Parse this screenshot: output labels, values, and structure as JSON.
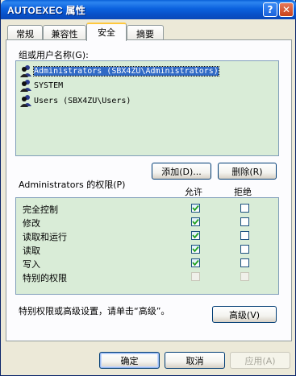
{
  "window": {
    "title": "AUTOEXEC 属性"
  },
  "titlebar": {
    "help_label": "?",
    "close_label": "✕"
  },
  "tabs": [
    {
      "label": "常规",
      "active": false
    },
    {
      "label": "兼容性",
      "active": false
    },
    {
      "label": "安全",
      "active": true
    },
    {
      "label": "摘要",
      "active": false
    }
  ],
  "security": {
    "group_label": "组或用户名称(G):",
    "users": [
      {
        "name": "Administrators (SBX4ZU\\Administrators)",
        "selected": true,
        "icon": "users-icon"
      },
      {
        "name": "SYSTEM",
        "selected": false,
        "icon": "users-icon"
      },
      {
        "name": "Users (SBX4ZU\\Users)",
        "selected": false,
        "icon": "users-icon"
      }
    ],
    "add_label": "添加(D)...",
    "remove_label": "删除(R)",
    "perm_title": "Administrators 的权限(P)",
    "allow_header": "允许",
    "deny_header": "拒绝",
    "permissions": [
      {
        "name": "完全控制",
        "allow": true,
        "deny": false,
        "enabled": true
      },
      {
        "name": "修改",
        "allow": true,
        "deny": false,
        "enabled": true
      },
      {
        "name": "读取和运行",
        "allow": true,
        "deny": false,
        "enabled": true
      },
      {
        "name": "读取",
        "allow": true,
        "deny": false,
        "enabled": true
      },
      {
        "name": "写入",
        "allow": true,
        "deny": false,
        "enabled": true
      },
      {
        "name": "特别的权限",
        "allow": false,
        "deny": false,
        "enabled": false
      }
    ],
    "advanced_hint": "特别权限或高级设置，请单击“高级”。",
    "advanced_label": "高级(V)"
  },
  "footer": {
    "ok_label": "确定",
    "cancel_label": "取消",
    "apply_label": "应用(A)"
  },
  "colors": {
    "title_blue": "#0b61de",
    "list_bg": "#d9ecd7",
    "tab_accent": "#ffc83c",
    "selection": "#316ac5"
  }
}
